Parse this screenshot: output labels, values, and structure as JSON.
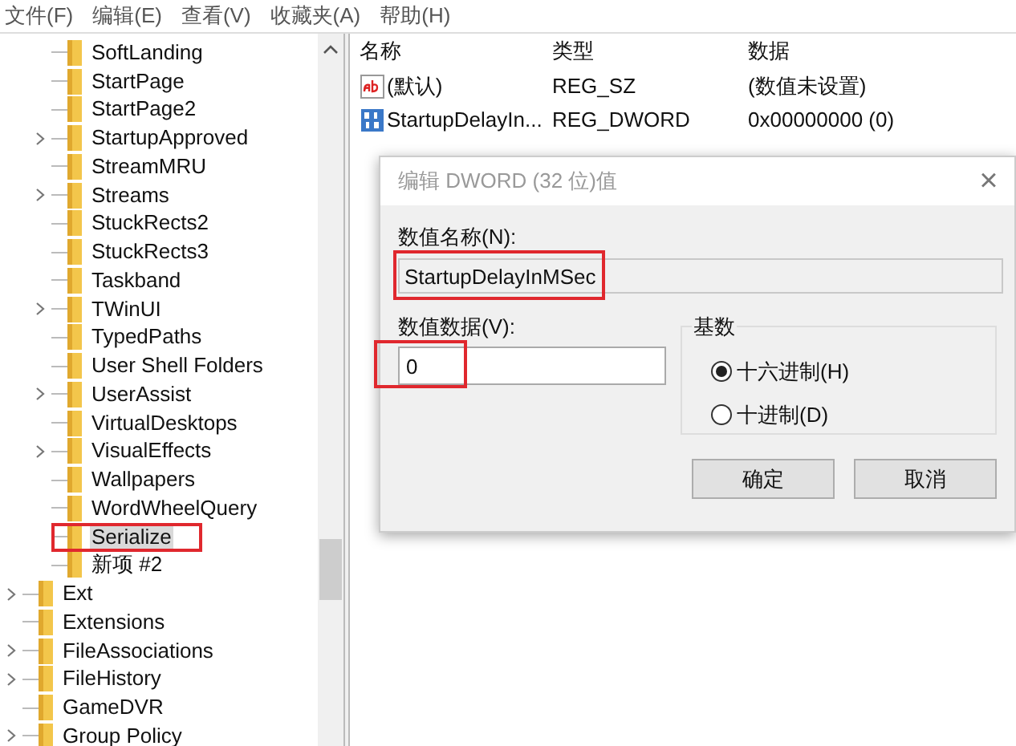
{
  "menu": [
    "文件(F)",
    "编辑(E)",
    "查看(V)",
    "收藏夹(A)",
    "帮助(H)"
  ],
  "tree": [
    {
      "children": [
        {
          "label": "SoftLanding",
          "expandable": false,
          "selected": false,
          "annotated": false
        },
        {
          "label": "StartPage",
          "expandable": false,
          "selected": false,
          "annotated": false
        },
        {
          "label": "StartPage2",
          "expandable": false,
          "selected": false,
          "annotated": false
        },
        {
          "label": "StartupApproved",
          "expandable": true,
          "selected": false,
          "annotated": false
        },
        {
          "label": "StreamMRU",
          "expandable": false,
          "selected": false,
          "annotated": false
        },
        {
          "label": "Streams",
          "expandable": true,
          "selected": false,
          "annotated": false
        },
        {
          "label": "StuckRects2",
          "expandable": false,
          "selected": false,
          "annotated": false
        },
        {
          "label": "StuckRects3",
          "expandable": false,
          "selected": false,
          "annotated": false
        },
        {
          "label": "Taskband",
          "expandable": false,
          "selected": false,
          "annotated": false
        },
        {
          "label": "TWinUI",
          "expandable": true,
          "selected": false,
          "annotated": false
        },
        {
          "label": "TypedPaths",
          "expandable": false,
          "selected": false,
          "annotated": false
        },
        {
          "label": "User Shell Folders",
          "expandable": false,
          "selected": false,
          "annotated": false
        },
        {
          "label": "UserAssist",
          "expandable": true,
          "selected": false,
          "annotated": false
        },
        {
          "label": "VirtualDesktops",
          "expandable": false,
          "selected": false,
          "annotated": false
        },
        {
          "label": "VisualEffects",
          "expandable": true,
          "selected": false,
          "annotated": false
        },
        {
          "label": "Wallpapers",
          "expandable": false,
          "selected": false,
          "annotated": false
        },
        {
          "label": "WordWheelQuery",
          "expandable": false,
          "selected": false,
          "annotated": false
        },
        {
          "label": "Serialize",
          "expandable": false,
          "selected": true,
          "annotated": true
        },
        {
          "label": "新项 #2",
          "expandable": false,
          "selected": false,
          "annotated": false
        }
      ]
    },
    {
      "label": "Ext",
      "expandable": true,
      "selected": false,
      "annotated": false
    },
    {
      "label": "Extensions",
      "expandable": false,
      "selected": false,
      "annotated": false
    },
    {
      "label": "FileAssociations",
      "expandable": true,
      "selected": false,
      "annotated": false
    },
    {
      "label": "FileHistory",
      "expandable": true,
      "selected": false,
      "annotated": false
    },
    {
      "label": "GameDVR",
      "expandable": false,
      "selected": false,
      "annotated": false
    },
    {
      "label": "Group Policy",
      "expandable": true,
      "selected": false,
      "annotated": false
    }
  ],
  "values": {
    "columns": [
      "名称",
      "类型",
      "数据"
    ],
    "rows": [
      {
        "kind": "string",
        "name": "(默认)",
        "type": "REG_SZ",
        "data": "(数值未设置)"
      },
      {
        "kind": "binary",
        "name": "StartupDelayIn...",
        "type": "REG_DWORD",
        "data": "0x00000000 (0)"
      }
    ]
  },
  "dialog": {
    "title": "编辑 DWORD (32 位)值",
    "close": "×",
    "name_label": "数值名称(N):",
    "name_value": "StartupDelayInMSec",
    "name_annotated": true,
    "data_label": "数值数据(V):",
    "data_value": "0",
    "data_annotated": true,
    "base_label": "基数",
    "base_options": [
      {
        "label": "十六进制(H)",
        "selected": true
      },
      {
        "label": "十进制(D)",
        "selected": false
      }
    ],
    "buttons": [
      "确定",
      "取消"
    ]
  }
}
